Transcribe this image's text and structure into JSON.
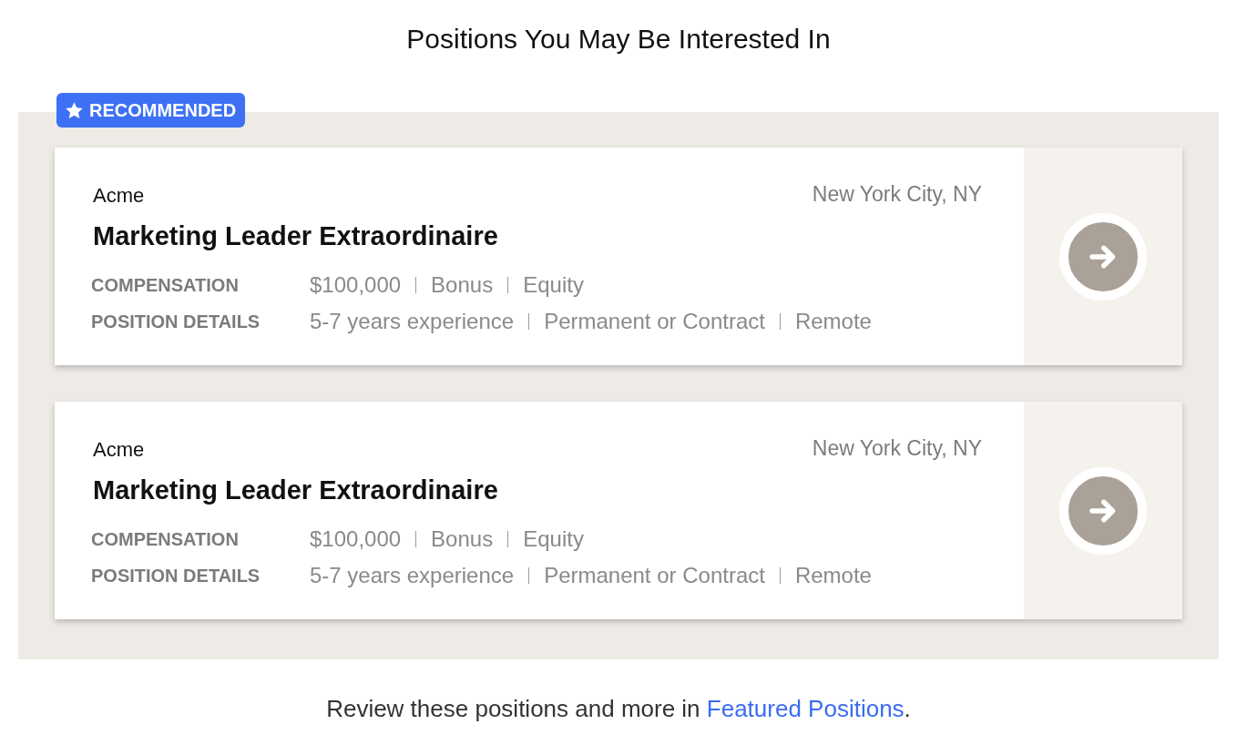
{
  "heading": "Positions You May Be Interested In",
  "badge": {
    "label": "RECOMMENDED"
  },
  "positions": [
    {
      "company": "Acme",
      "title": "Marketing Leader Extraordinaire",
      "location": "New York City, NY",
      "details": [
        {
          "label": "COMPENSATION",
          "values": [
            "$100,000",
            "Bonus",
            "Equity"
          ]
        },
        {
          "label": "POSITION DETAILS",
          "values": [
            "5-7 years experience",
            "Permanent or Contract",
            "Remote"
          ]
        }
      ]
    },
    {
      "company": "Acme",
      "title": "Marketing Leader Extraordinaire",
      "location": "New York City, NY",
      "details": [
        {
          "label": "COMPENSATION",
          "values": [
            "$100,000",
            "Bonus",
            "Equity"
          ]
        },
        {
          "label": "POSITION DETAILS",
          "values": [
            "5-7 years experience",
            "Permanent or Contract",
            "Remote"
          ]
        }
      ]
    }
  ],
  "footer": {
    "text": "Review these positions and more in ",
    "link": "Featured Positions",
    "end": "."
  }
}
